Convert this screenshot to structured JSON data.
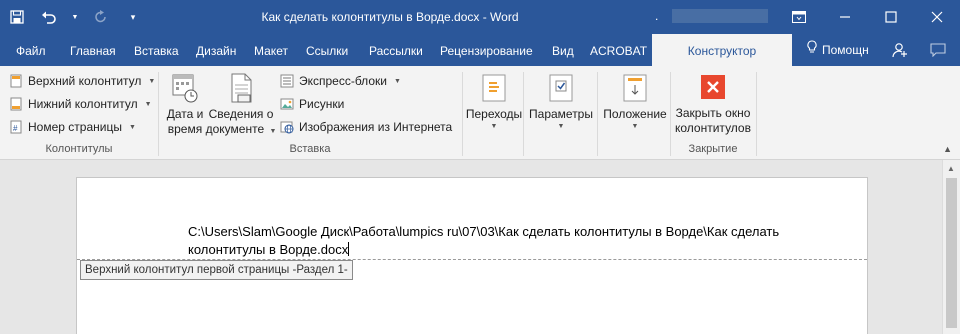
{
  "titlebar": {
    "title": "Как сделать колонтитулы в Ворде.docx - Word",
    "blur_dot": ".",
    "save_icon": "save-icon",
    "undo_icon": "undo-icon",
    "redo_icon": "redo-icon",
    "customize_icon": "customize-qat-icon"
  },
  "tabs": [
    "Файл",
    "Главная",
    "Вставка",
    "Дизайн",
    "Макет",
    "Ссылки",
    "Рассылки",
    "Рецензирование",
    "Вид",
    "ACROBAT",
    "Конструктор"
  ],
  "help": "Помощн",
  "ribbon": {
    "groups": {
      "headers": {
        "label": "Колонтитулы",
        "items": [
          "Верхний колонтитул",
          "Нижний колонтитул",
          "Номер страницы"
        ]
      },
      "insert": {
        "label": "Вставка",
        "date_time": [
          "Дата и",
          "время"
        ],
        "doc_info": [
          "Сведения о",
          "документе"
        ],
        "items": [
          "Экспресс-блоки",
          "Рисунки",
          "Изображения из Интернета"
        ]
      },
      "nav": {
        "label": "Переходы"
      },
      "options": {
        "label": "Параметры"
      },
      "position": {
        "label": "Положение"
      },
      "close": {
        "label": "Закрытие",
        "button": [
          "Закрыть окно",
          "колонтитулов"
        ]
      }
    }
  },
  "document": {
    "header_text": "C:\\Users\\Slam\\Google Диск\\Работа\\lumpics ru\\07\\03\\Как сделать колонтитулы в Ворде\\Как сделать колонтитулы в Ворде.docx",
    "header_tag": "Верхний колонтитул первой страницы -Раздел 1-"
  },
  "colors": {
    "accent": "#2b579a",
    "close_red": "#e8472e"
  }
}
